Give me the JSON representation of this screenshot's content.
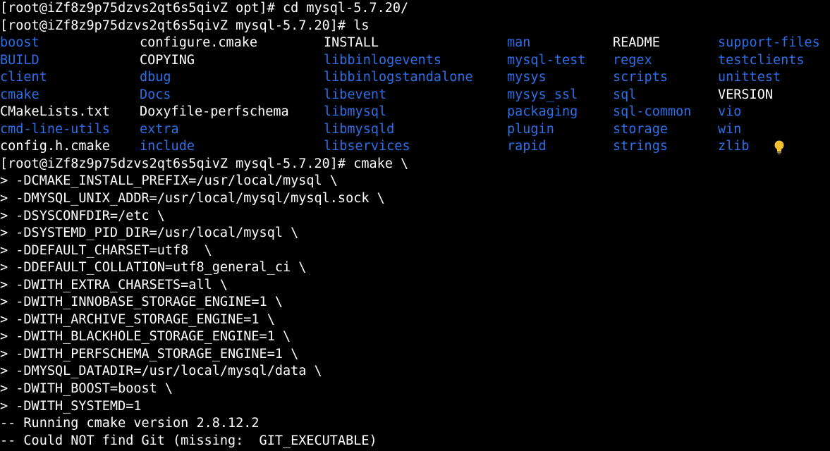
{
  "colors": {
    "background": "#000000",
    "text": "#ffffff",
    "directory": "#2c6fe8",
    "bulb": "#f2c230"
  },
  "terminal": {
    "line_cd": "[root@iZf8z9p75dzvs2qt6s5qivZ opt]# cd mysql-5.7.20/",
    "line_ls": "[root@iZf8z9p75dzvs2qt6s5qivZ mysql-5.7.20]# ls",
    "ls_rows": [
      [
        {
          "name": "boost",
          "type": "dir"
        },
        {
          "name": "configure.cmake",
          "type": "file"
        },
        {
          "name": "INSTALL",
          "type": "file"
        },
        {
          "name": "man",
          "type": "dir"
        },
        {
          "name": "README",
          "type": "file"
        },
        {
          "name": "support-files",
          "type": "dir"
        }
      ],
      [
        {
          "name": "BUILD",
          "type": "dir"
        },
        {
          "name": "COPYING",
          "type": "file"
        },
        {
          "name": "libbinlogevents",
          "type": "dir"
        },
        {
          "name": "mysql-test",
          "type": "dir"
        },
        {
          "name": "regex",
          "type": "dir"
        },
        {
          "name": "testclients",
          "type": "dir"
        }
      ],
      [
        {
          "name": "client",
          "type": "dir"
        },
        {
          "name": "dbug",
          "type": "dir"
        },
        {
          "name": "libbinlogstandalone",
          "type": "dir"
        },
        {
          "name": "mysys",
          "type": "dir"
        },
        {
          "name": "scripts",
          "type": "dir"
        },
        {
          "name": "unittest",
          "type": "dir"
        }
      ],
      [
        {
          "name": "cmake",
          "type": "dir"
        },
        {
          "name": "Docs",
          "type": "dir"
        },
        {
          "name": "libevent",
          "type": "dir"
        },
        {
          "name": "mysys_ssl",
          "type": "dir"
        },
        {
          "name": "sql",
          "type": "dir"
        },
        {
          "name": "VERSION",
          "type": "file"
        }
      ],
      [
        {
          "name": "CMakeLists.txt",
          "type": "file"
        },
        {
          "name": "Doxyfile-perfschema",
          "type": "file"
        },
        {
          "name": "libmysql",
          "type": "dir"
        },
        {
          "name": "packaging",
          "type": "dir"
        },
        {
          "name": "sql-common",
          "type": "dir"
        },
        {
          "name": "vio",
          "type": "dir"
        }
      ],
      [
        {
          "name": "cmd-line-utils",
          "type": "dir"
        },
        {
          "name": "extra",
          "type": "dir"
        },
        {
          "name": "libmysqld",
          "type": "dir"
        },
        {
          "name": "plugin",
          "type": "dir"
        },
        {
          "name": "storage",
          "type": "dir"
        },
        {
          "name": "win",
          "type": "dir"
        }
      ],
      [
        {
          "name": "config.h.cmake",
          "type": "file"
        },
        {
          "name": "include",
          "type": "dir"
        },
        {
          "name": "libservices",
          "type": "dir"
        },
        {
          "name": "rapid",
          "type": "dir"
        },
        {
          "name": "strings",
          "type": "dir"
        },
        {
          "name": "zlib",
          "type": "dir"
        }
      ]
    ],
    "bulb_icon": "lightbulb-icon",
    "cmake_lines": [
      "[root@iZf8z9p75dzvs2qt6s5qivZ mysql-5.7.20]# cmake \\",
      "> -DCMAKE_INSTALL_PREFIX=/usr/local/mysql \\",
      "> -DMYSQL_UNIX_ADDR=/usr/local/mysql/mysql.sock \\",
      "> -DSYSCONFDIR=/etc \\",
      "> -DSYSTEMD_PID_DIR=/usr/local/mysql \\",
      "> -DDEFAULT_CHARSET=utf8  \\",
      "> -DDEFAULT_COLLATION=utf8_general_ci \\",
      "> -DWITH_EXTRA_CHARSETS=all \\",
      "> -DWITH_INNOBASE_STORAGE_ENGINE=1 \\",
      "> -DWITH_ARCHIVE_STORAGE_ENGINE=1 \\",
      "> -DWITH_BLACKHOLE_STORAGE_ENGINE=1 \\",
      "> -DWITH_PERFSCHEMA_STORAGE_ENGINE=1 \\",
      "> -DMYSQL_DATADIR=/usr/local/mysql/data \\",
      "> -DWITH_BOOST=boost \\",
      "> -DWITH_SYSTEMD=1",
      "-- Running cmake version 2.8.12.2",
      "-- Could NOT find Git (missing:  GIT_EXECUTABLE)"
    ]
  }
}
